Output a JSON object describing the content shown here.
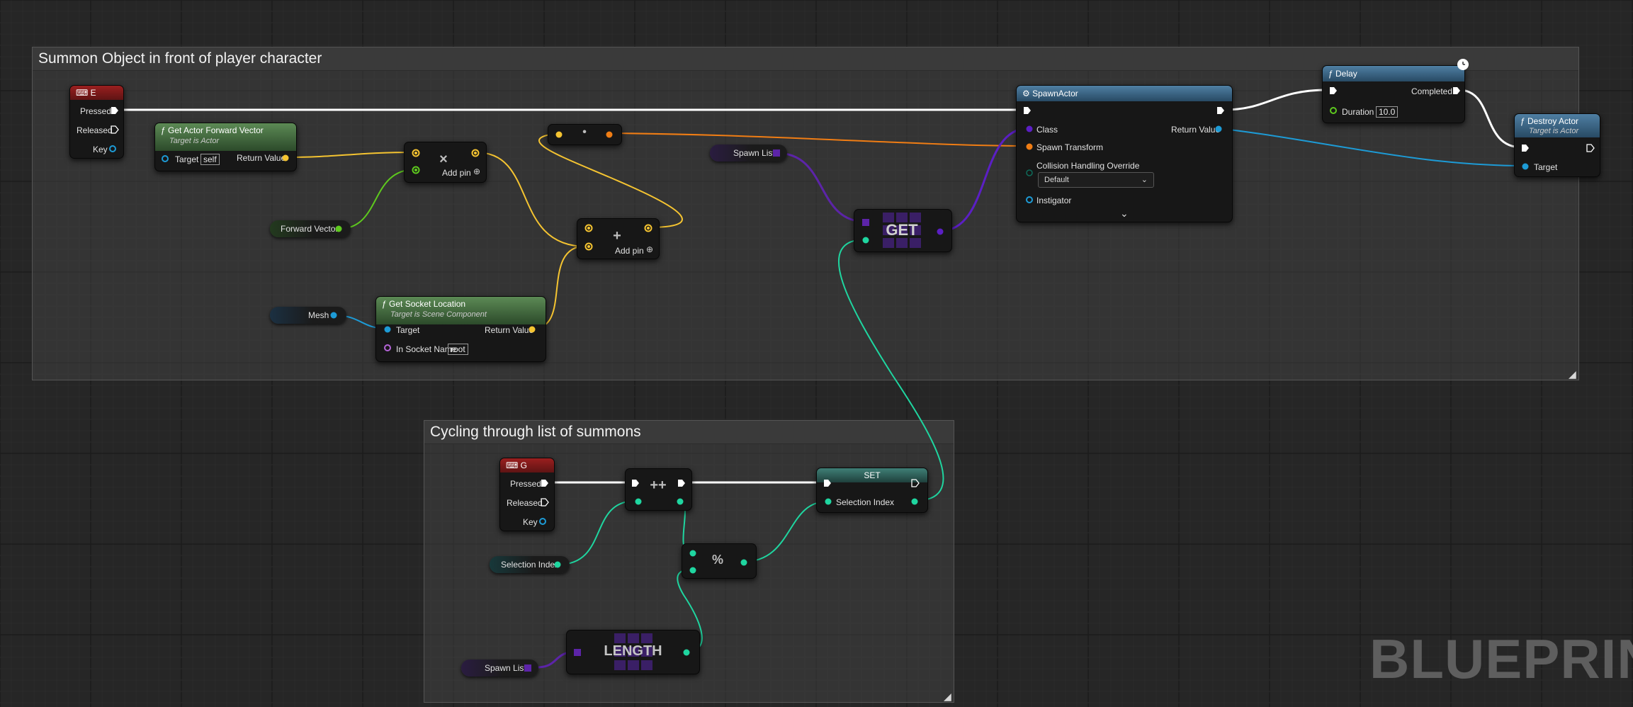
{
  "comments": {
    "summon": {
      "title": "Summon Object in front of player character"
    },
    "cycling": {
      "title": "Cycling through list of summons"
    }
  },
  "event_e": {
    "title": "E",
    "pressed": "Pressed",
    "released": "Released",
    "key": "Key"
  },
  "forward_vector": {
    "title": "Get Actor Forward Vector",
    "subtitle": "Target is Actor",
    "target": "Target",
    "target_value": "self",
    "return_value": "Return Value"
  },
  "multiply": {
    "symbol": "×",
    "add_pin": "Add pin"
  },
  "dot_node": {
    "symbol": "•"
  },
  "add_node": {
    "symbol": "+",
    "add_pin": "Add pin"
  },
  "forward_vector_var": {
    "label": "Forward Vector"
  },
  "mesh_var": {
    "label": "Mesh"
  },
  "socket_location": {
    "title": "Get Socket Location",
    "subtitle": "Target is Scene Component",
    "target": "Target",
    "return_value": "Return Value",
    "socket_name": "In Socket Name",
    "socket_value": "root"
  },
  "spawn_list_var_top": {
    "label": "Spawn List"
  },
  "get_node": {
    "label": "GET"
  },
  "spawn_actor": {
    "title": "SpawnActor",
    "class": "Class",
    "spawn_transform": "Spawn Transform",
    "collision": "Collision Handling Override",
    "collision_value": "Default",
    "instigator": "Instigator",
    "return_value": "Return Value"
  },
  "delay": {
    "title": "Delay",
    "completed": "Completed",
    "duration": "Duration",
    "duration_value": "10.0"
  },
  "destroy_actor": {
    "title": "Destroy Actor",
    "subtitle": "Target is Actor",
    "target": "Target"
  },
  "event_g": {
    "title": "G",
    "pressed": "Pressed",
    "released": "Released",
    "key": "Key"
  },
  "increment": {
    "symbol": "++"
  },
  "set_node": {
    "title": "SET",
    "selection_index": "Selection Index"
  },
  "modulo": {
    "symbol": "%"
  },
  "selection_index_var": {
    "label": "Selection Index"
  },
  "length_node": {
    "label": "LENGTH"
  },
  "spawn_list_var_bottom": {
    "label": "Spawn List"
  },
  "watermark": {
    "text": "BLUEPRINT"
  },
  "colors": {
    "exec": "#ffffff",
    "vector": "#f5c431",
    "object": "#1d9bd6",
    "class": "#5b1fc4",
    "transform": "#f07d14",
    "integer": "#1fd6a0",
    "struct_green": "#5ec91e",
    "name": "#b464d8",
    "array_purple": "#5c24a8"
  }
}
